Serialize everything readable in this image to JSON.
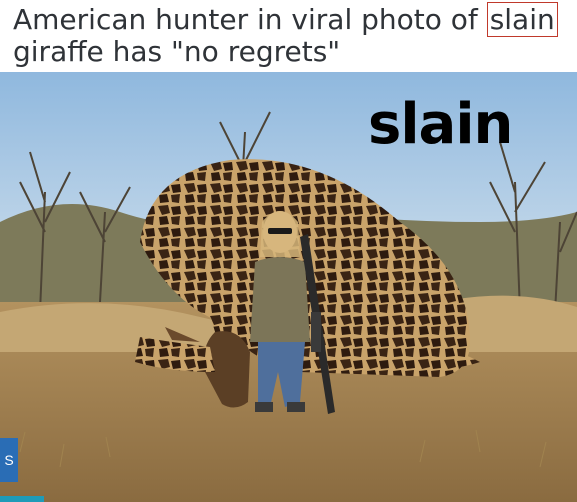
{
  "headline": {
    "before": "American hunter in viral photo of ",
    "highlighted": "slain",
    "after": " giraffe has \"no regrets\""
  },
  "photo": {
    "overlay_word": "slain"
  },
  "side_tab": {
    "label": "S"
  },
  "colors": {
    "headline_text": "#2f3338",
    "highlight_box": "#c0392b",
    "side_tab": "#2a6db5",
    "side_tab_bar": "#1f9bb8"
  }
}
